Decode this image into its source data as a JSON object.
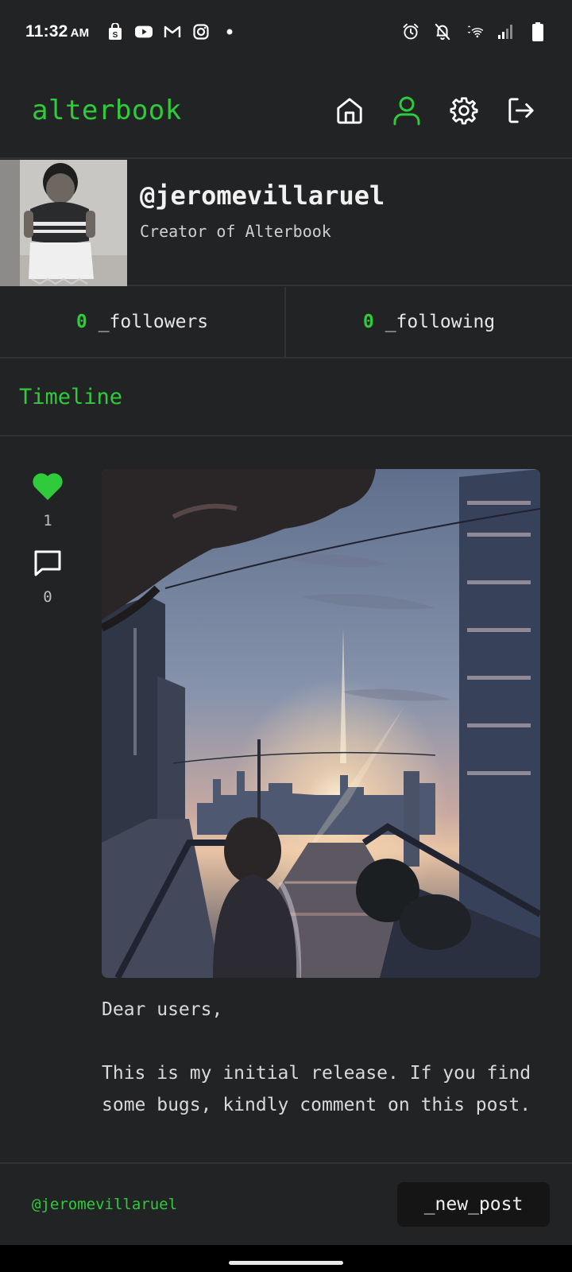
{
  "status_bar": {
    "time": "11:32",
    "ampm": "AM"
  },
  "header": {
    "brand": "alterbook",
    "nav": [
      {
        "icon": "home-icon"
      },
      {
        "icon": "profile-icon",
        "active": true
      },
      {
        "icon": "settings-icon"
      },
      {
        "icon": "logout-icon"
      }
    ]
  },
  "profile": {
    "handle": "@jeromevillaruel",
    "bio": "Creator of Alterbook"
  },
  "stats": {
    "followers_count": "0",
    "followers_label": "_followers",
    "following_count": "0",
    "following_label": "_following"
  },
  "section": {
    "title": "Timeline"
  },
  "post": {
    "likes": "1",
    "comments": "0",
    "body": "Dear users,\n\nThis is my initial release. If you find\nsome bugs, kindly comment on this post."
  },
  "footer": {
    "handle": "@jeromevillaruel",
    "new_post_label": "_new_post"
  },
  "colors": {
    "accent": "#2fcb3a",
    "background": "#222325",
    "divider": "#303236"
  }
}
